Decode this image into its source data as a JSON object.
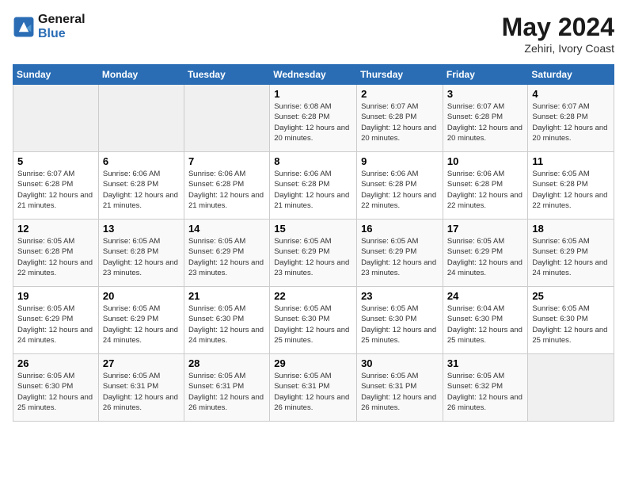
{
  "logo": {
    "line1": "General",
    "line2": "Blue"
  },
  "title": {
    "month_year": "May 2024",
    "location": "Zehiri, Ivory Coast"
  },
  "days_of_week": [
    "Sunday",
    "Monday",
    "Tuesday",
    "Wednesday",
    "Thursday",
    "Friday",
    "Saturday"
  ],
  "weeks": [
    [
      {
        "day": "",
        "info": ""
      },
      {
        "day": "",
        "info": ""
      },
      {
        "day": "",
        "info": ""
      },
      {
        "day": "1",
        "info": "Sunrise: 6:08 AM\nSunset: 6:28 PM\nDaylight: 12 hours and 20 minutes."
      },
      {
        "day": "2",
        "info": "Sunrise: 6:07 AM\nSunset: 6:28 PM\nDaylight: 12 hours and 20 minutes."
      },
      {
        "day": "3",
        "info": "Sunrise: 6:07 AM\nSunset: 6:28 PM\nDaylight: 12 hours and 20 minutes."
      },
      {
        "day": "4",
        "info": "Sunrise: 6:07 AM\nSunset: 6:28 PM\nDaylight: 12 hours and 20 minutes."
      }
    ],
    [
      {
        "day": "5",
        "info": "Sunrise: 6:07 AM\nSunset: 6:28 PM\nDaylight: 12 hours and 21 minutes."
      },
      {
        "day": "6",
        "info": "Sunrise: 6:06 AM\nSunset: 6:28 PM\nDaylight: 12 hours and 21 minutes."
      },
      {
        "day": "7",
        "info": "Sunrise: 6:06 AM\nSunset: 6:28 PM\nDaylight: 12 hours and 21 minutes."
      },
      {
        "day": "8",
        "info": "Sunrise: 6:06 AM\nSunset: 6:28 PM\nDaylight: 12 hours and 21 minutes."
      },
      {
        "day": "9",
        "info": "Sunrise: 6:06 AM\nSunset: 6:28 PM\nDaylight: 12 hours and 22 minutes."
      },
      {
        "day": "10",
        "info": "Sunrise: 6:06 AM\nSunset: 6:28 PM\nDaylight: 12 hours and 22 minutes."
      },
      {
        "day": "11",
        "info": "Sunrise: 6:05 AM\nSunset: 6:28 PM\nDaylight: 12 hours and 22 minutes."
      }
    ],
    [
      {
        "day": "12",
        "info": "Sunrise: 6:05 AM\nSunset: 6:28 PM\nDaylight: 12 hours and 22 minutes."
      },
      {
        "day": "13",
        "info": "Sunrise: 6:05 AM\nSunset: 6:28 PM\nDaylight: 12 hours and 23 minutes."
      },
      {
        "day": "14",
        "info": "Sunrise: 6:05 AM\nSunset: 6:29 PM\nDaylight: 12 hours and 23 minutes."
      },
      {
        "day": "15",
        "info": "Sunrise: 6:05 AM\nSunset: 6:29 PM\nDaylight: 12 hours and 23 minutes."
      },
      {
        "day": "16",
        "info": "Sunrise: 6:05 AM\nSunset: 6:29 PM\nDaylight: 12 hours and 23 minutes."
      },
      {
        "day": "17",
        "info": "Sunrise: 6:05 AM\nSunset: 6:29 PM\nDaylight: 12 hours and 24 minutes."
      },
      {
        "day": "18",
        "info": "Sunrise: 6:05 AM\nSunset: 6:29 PM\nDaylight: 12 hours and 24 minutes."
      }
    ],
    [
      {
        "day": "19",
        "info": "Sunrise: 6:05 AM\nSunset: 6:29 PM\nDaylight: 12 hours and 24 minutes."
      },
      {
        "day": "20",
        "info": "Sunrise: 6:05 AM\nSunset: 6:29 PM\nDaylight: 12 hours and 24 minutes."
      },
      {
        "day": "21",
        "info": "Sunrise: 6:05 AM\nSunset: 6:30 PM\nDaylight: 12 hours and 24 minutes."
      },
      {
        "day": "22",
        "info": "Sunrise: 6:05 AM\nSunset: 6:30 PM\nDaylight: 12 hours and 25 minutes."
      },
      {
        "day": "23",
        "info": "Sunrise: 6:05 AM\nSunset: 6:30 PM\nDaylight: 12 hours and 25 minutes."
      },
      {
        "day": "24",
        "info": "Sunrise: 6:04 AM\nSunset: 6:30 PM\nDaylight: 12 hours and 25 minutes."
      },
      {
        "day": "25",
        "info": "Sunrise: 6:05 AM\nSunset: 6:30 PM\nDaylight: 12 hours and 25 minutes."
      }
    ],
    [
      {
        "day": "26",
        "info": "Sunrise: 6:05 AM\nSunset: 6:30 PM\nDaylight: 12 hours and 25 minutes."
      },
      {
        "day": "27",
        "info": "Sunrise: 6:05 AM\nSunset: 6:31 PM\nDaylight: 12 hours and 26 minutes."
      },
      {
        "day": "28",
        "info": "Sunrise: 6:05 AM\nSunset: 6:31 PM\nDaylight: 12 hours and 26 minutes."
      },
      {
        "day": "29",
        "info": "Sunrise: 6:05 AM\nSunset: 6:31 PM\nDaylight: 12 hours and 26 minutes."
      },
      {
        "day": "30",
        "info": "Sunrise: 6:05 AM\nSunset: 6:31 PM\nDaylight: 12 hours and 26 minutes."
      },
      {
        "day": "31",
        "info": "Sunrise: 6:05 AM\nSunset: 6:32 PM\nDaylight: 12 hours and 26 minutes."
      },
      {
        "day": "",
        "info": ""
      }
    ]
  ]
}
